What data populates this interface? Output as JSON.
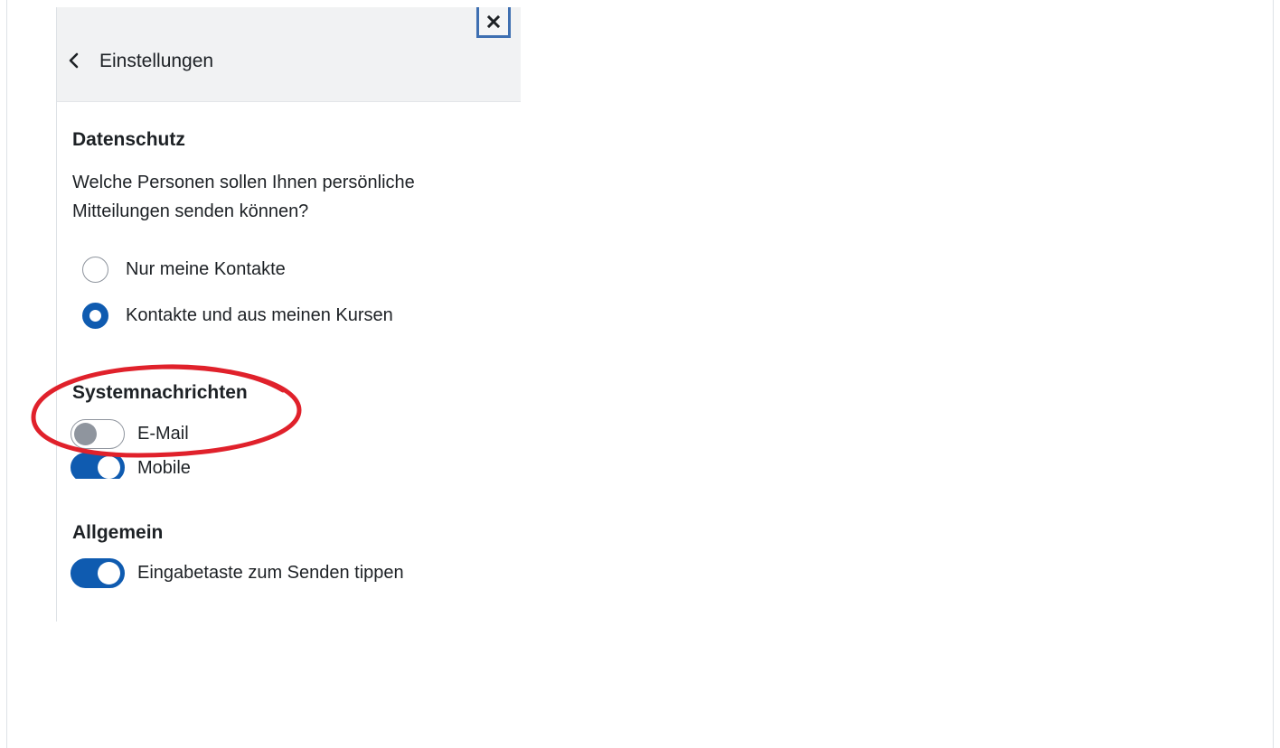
{
  "drawer": {
    "title": "Einstellungen",
    "back_icon": "chevron-left-icon",
    "close_icon": "close-icon"
  },
  "privacy": {
    "heading": "Datenschutz",
    "question": "Welche Personen sollen Ihnen persönliche Mitteilungen senden können?",
    "options": [
      {
        "label": "Nur meine Kontakte",
        "checked": false
      },
      {
        "label": "Kontakte und aus meinen Kursen",
        "checked": true
      }
    ]
  },
  "notifications": {
    "heading": "Systemnachrichten",
    "toggles": [
      {
        "label": "E-Mail",
        "on": false
      },
      {
        "label": "Mobile",
        "on": true
      }
    ]
  },
  "general": {
    "heading": "Allgemein",
    "toggles": [
      {
        "label": "Eingabetaste zum Senden tippen",
        "on": true
      }
    ]
  },
  "colors": {
    "accent": "#0f5bb0",
    "header_bg": "#f1f2f3",
    "annotation": "#e0212b",
    "focus_border": "#3e6fb1"
  }
}
